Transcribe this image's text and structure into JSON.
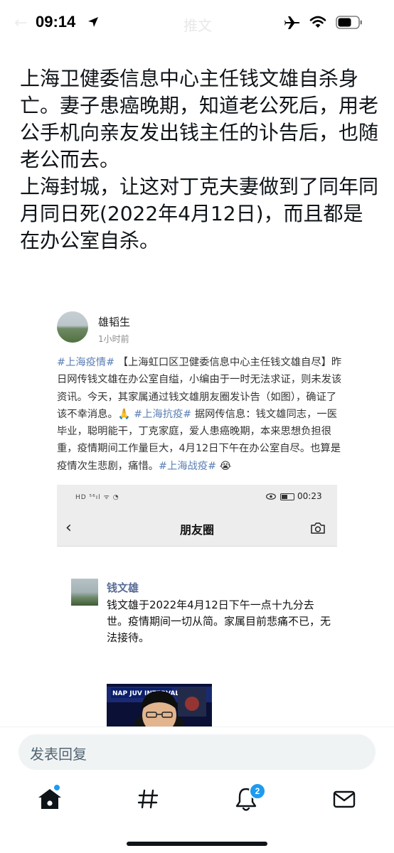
{
  "status_bar": {
    "time": "09:14",
    "icons": [
      "location-arrow-icon",
      "airplane-icon",
      "wifi-icon",
      "battery-icon"
    ]
  },
  "nav": {
    "back_glyph": "←",
    "title_ghost": "推文"
  },
  "tweet": {
    "paragraphs": [
      "上海卫健委信息中心主任钱文雄自杀身亡。妻子患癌晚期，知道老公死后，用老公手机向亲友发出钱主任的讣告后，也随老公而去。",
      "上海封城，让这对丁克夫妻做到了同年同月同日死(2022年4月12日)，而且都是在办公室自杀。"
    ]
  },
  "embedded_post": {
    "author": "雄韬生",
    "time": "1小时前",
    "body": {
      "tag1": "#上海疫情#",
      "text1": " 【上海虹口区卫健委信息中心主任钱文雄自尽】昨日网传钱文雄在办公室自缢，小编由于一时无法求证，则未发该资讯。今天，其家属通过钱文雄朋友圈发讣告（如图），确证了该不幸消息。",
      "emoji1": "🙏",
      "tag2": " #上海抗疫#",
      "text2": " 据网传信息：钱文雄同志，一医毕业，聪明能干，丁克家庭，爱人患癌晚期，本来思想负担很重，疫情期间工作量巨大，4月12日下午在办公室自尽。也算是疫情次生悲剧，痛惜。",
      "tag3": "#上海战疫#",
      "emoji2": "😭"
    },
    "moments": {
      "status_left": "HD ⁵⁶ıl ᯤ ◔",
      "status_time": "00:23",
      "title": "朋友圈",
      "author": "钱文雄",
      "text": "钱文雄于2022年4月12日下午一点十九分去世。疫情期间一切从简。家属目前悲痛不已，无法接待。",
      "photo_caption": "NAP   JUV   INTERVAL"
    }
  },
  "reply": {
    "placeholder": "发表回复"
  },
  "tab_bar": {
    "items": [
      "home-icon",
      "explore-icon",
      "notifications-icon",
      "messages-icon"
    ],
    "notification_badge": "2",
    "accent": "#1d9bf0"
  }
}
